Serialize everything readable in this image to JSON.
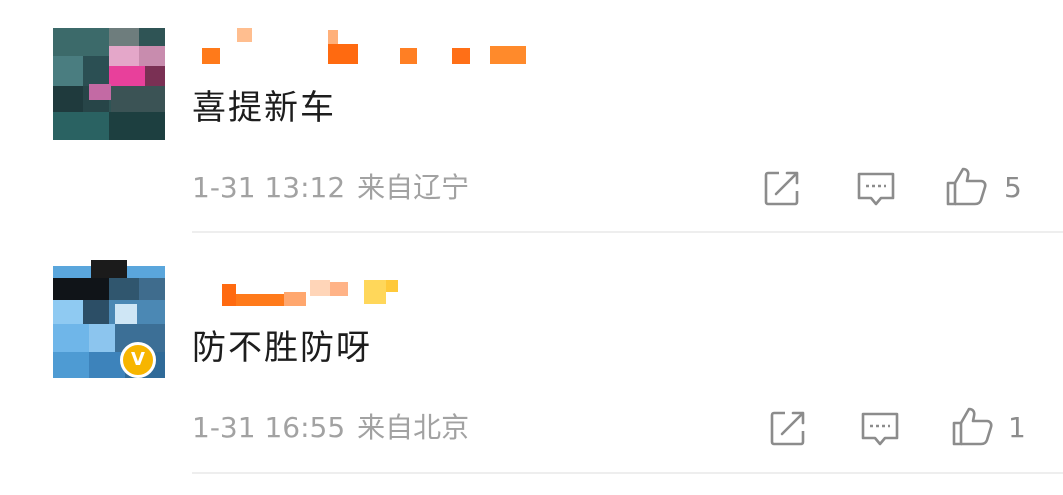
{
  "comments": [
    {
      "text": "喜提新车",
      "time": "1-31 13:12",
      "location": "来自辽宁",
      "likes": "5",
      "verified": false
    },
    {
      "text": "防不胜防呀",
      "time": "1-31 16:55",
      "location": "来自北京",
      "likes": "1",
      "verified": true
    }
  ],
  "icons": {
    "share": "share-icon",
    "comment": "comment-icon",
    "like": "thumbs-up-icon",
    "verified": "verified-badge-icon"
  },
  "colors": {
    "text": "#1d1d1d",
    "meta": "#a2a2a2",
    "icon": "#8c8c8c",
    "badge": "#f7b500",
    "username_mosaic": "#ff7a1a"
  }
}
